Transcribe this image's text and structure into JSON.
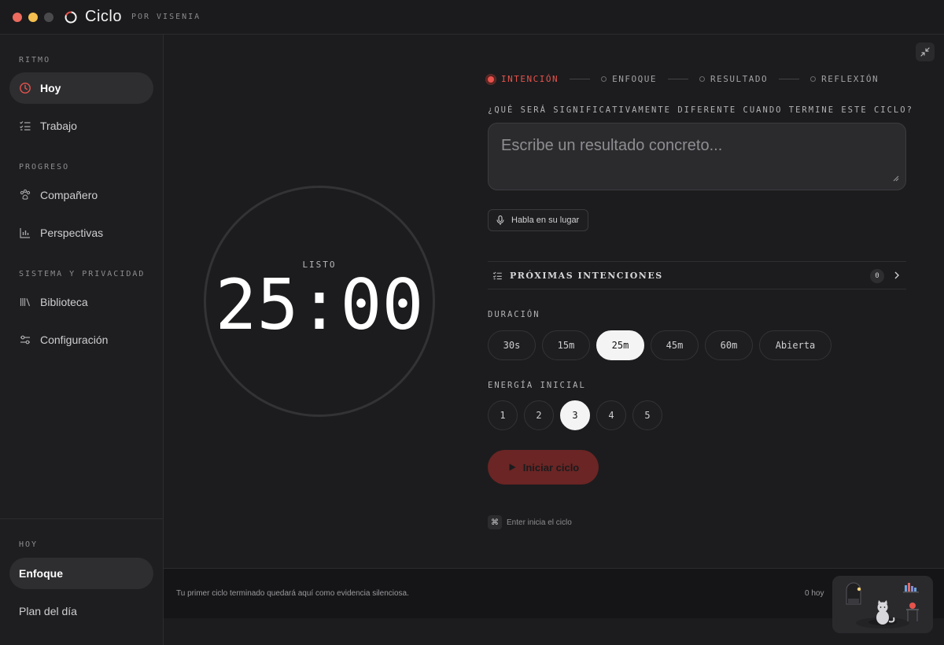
{
  "app": {
    "name": "Ciclo",
    "subtitle": "POR VISENIA"
  },
  "sidebar": {
    "sections": [
      {
        "label": "RITMO",
        "items": [
          {
            "label": "Hoy",
            "icon": "clock-icon",
            "active": true
          },
          {
            "label": "Trabajo",
            "icon": "checklist-icon"
          }
        ]
      },
      {
        "label": "PROGRESO",
        "items": [
          {
            "label": "Compañero",
            "icon": "paw-icon"
          },
          {
            "label": "Perspectivas",
            "icon": "bar-chart-icon"
          }
        ]
      },
      {
        "label": "SISTEMA Y PRIVACIDAD",
        "items": [
          {
            "label": "Biblioteca",
            "icon": "library-icon"
          },
          {
            "label": "Configuración",
            "icon": "sliders-icon"
          }
        ]
      }
    ],
    "bottom": {
      "label": "HOY",
      "items": [
        {
          "label": "Enfoque",
          "active": true
        },
        {
          "label": "Plan del día"
        }
      ]
    }
  },
  "timer": {
    "status": "LISTO",
    "time": "25:00"
  },
  "stepper": {
    "steps": [
      "INTENCIÓN",
      "ENFOQUE",
      "RESULTADO",
      "REFLEXIÓN"
    ],
    "active_index": 0
  },
  "intention": {
    "question": "¿QUÉ SERÁ SIGNIFICATIVAMENTE DIFERENTE CUANDO TERMINE ESTE CICLO?",
    "placeholder": "Escribe un resultado concreto...",
    "value": "",
    "voice_label": "Habla en su lugar"
  },
  "upcoming": {
    "title": "PRÓXIMAS INTENCIONES",
    "count": "0"
  },
  "duration": {
    "label": "DURACIÓN",
    "options": [
      "30s",
      "15m",
      "25m",
      "45m",
      "60m",
      "Abierta"
    ],
    "selected": "25m"
  },
  "energy": {
    "label": "ENERGÍA INICIAL",
    "options": [
      "1",
      "2",
      "3",
      "4",
      "5"
    ],
    "selected": "3"
  },
  "start_label": "Iniciar ciclo",
  "hint": {
    "key": "⌘",
    "text": "Enter inicia el ciclo"
  },
  "footer": {
    "message": "Tu primer ciclo terminado quedará aquí como evidencia silenciosa.",
    "count": "0 hoy"
  },
  "colors": {
    "accent": "#e6534c",
    "start_button": "#6b2524",
    "background": "#1c1c1e",
    "sidebar": "#1e1e20"
  }
}
